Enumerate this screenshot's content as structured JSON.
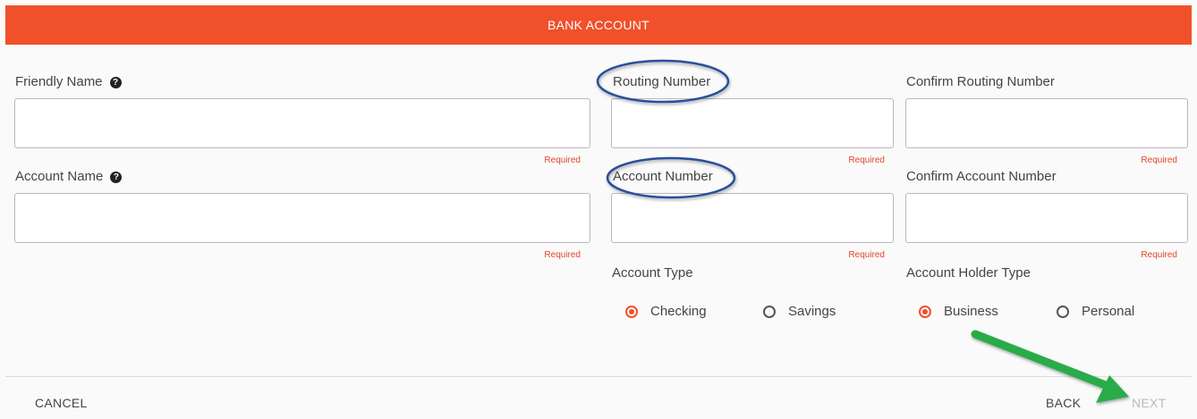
{
  "header": {
    "title": "BANK ACCOUNT"
  },
  "fields": {
    "friendly_name": {
      "label": "Friendly Name",
      "value": "",
      "hint": "Required"
    },
    "routing_number": {
      "label": "Routing Number",
      "value": "",
      "hint": "Required"
    },
    "confirm_routing_number": {
      "label": "Confirm Routing Number",
      "value": "",
      "hint": "Required"
    },
    "account_name": {
      "label": "Account Name",
      "value": "",
      "hint": "Required"
    },
    "account_number": {
      "label": "Account Number",
      "value": "",
      "hint": "Required"
    },
    "confirm_account_number": {
      "label": "Confirm Account Number",
      "value": "",
      "hint": "Required"
    }
  },
  "account_type": {
    "label": "Account Type",
    "options": [
      "Checking",
      "Savings"
    ],
    "selected": "Checking"
  },
  "account_holder_type": {
    "label": "Account Holder Type",
    "options": [
      "Business",
      "Personal"
    ],
    "selected": "Business"
  },
  "footer": {
    "cancel": "CANCEL",
    "back": "BACK",
    "next": "NEXT"
  },
  "colors": {
    "accent": "#f0502a",
    "annotation_circle": "#2c4f9a",
    "annotation_arrow": "#2bab4a",
    "required_text": "#e0472b",
    "disabled_text": "#bbbbbb"
  }
}
